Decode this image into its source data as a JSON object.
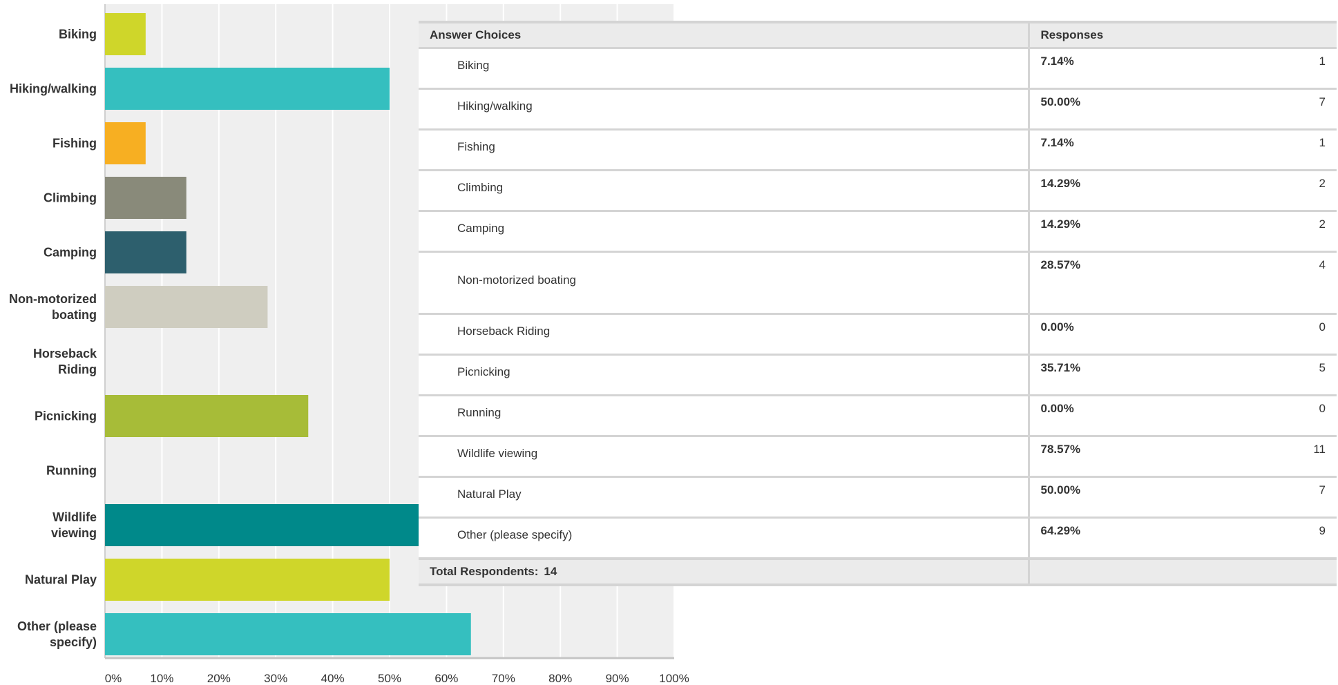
{
  "chart_data": {
    "type": "bar",
    "orientation": "horizontal",
    "categories": [
      [
        "Biking"
      ],
      [
        "Hiking/walking"
      ],
      [
        "Fishing"
      ],
      [
        "Climbing"
      ],
      [
        "Camping"
      ],
      [
        "Non-motorized",
        "boating"
      ],
      [
        "Horseback",
        "Riding"
      ],
      [
        "Picnicking"
      ],
      [
        "Running"
      ],
      [
        "Wildlife",
        "viewing"
      ],
      [
        "Natural Play"
      ],
      [
        "Other (please",
        "specify)"
      ]
    ],
    "values": [
      7.14,
      50.0,
      7.14,
      14.29,
      14.29,
      28.57,
      0.0,
      35.71,
      0.0,
      78.57,
      50.0,
      64.29
    ],
    "colors": [
      "#cfd62a",
      "#35bfbf",
      "#f7af22",
      "#898a7a",
      "#2d5f6d",
      "#cfcdc0",
      "#8aa63a",
      "#a7bc38",
      "#d6d6d6",
      "#00898a",
      "#cfd62a",
      "#35bfbf"
    ],
    "xlim": [
      0,
      100
    ],
    "xticks": [
      "0%",
      "10%",
      "20%",
      "30%",
      "40%",
      "50%",
      "60%",
      "70%",
      "80%",
      "90%",
      "100%"
    ],
    "grid": true,
    "title": "",
    "xlabel": "",
    "ylabel": ""
  },
  "table": {
    "header": {
      "choices": "Answer Choices",
      "responses": "Responses"
    },
    "rows": [
      {
        "choice": "Biking",
        "percent": "7.14%",
        "count": "1"
      },
      {
        "choice": "Hiking/walking",
        "percent": "50.00%",
        "count": "7"
      },
      {
        "choice": "Fishing",
        "percent": "7.14%",
        "count": "1"
      },
      {
        "choice": "Climbing",
        "percent": "14.29%",
        "count": "2"
      },
      {
        "choice": "Camping",
        "percent": "14.29%",
        "count": "2"
      },
      {
        "choice": "Non-motorized boating",
        "percent": "28.57%",
        "count": "4"
      },
      {
        "choice": "Horseback Riding",
        "percent": "0.00%",
        "count": "0"
      },
      {
        "choice": "Picnicking",
        "percent": "35.71%",
        "count": "5"
      },
      {
        "choice": "Running",
        "percent": "0.00%",
        "count": "0"
      },
      {
        "choice": "Wildlife viewing",
        "percent": "78.57%",
        "count": "11"
      },
      {
        "choice": "Natural Play",
        "percent": "50.00%",
        "count": "7"
      },
      {
        "choice": "Other (please specify)",
        "percent": "64.29%",
        "count": "9"
      }
    ],
    "footer": {
      "label": "Total Respondents:",
      "value": "14"
    }
  }
}
